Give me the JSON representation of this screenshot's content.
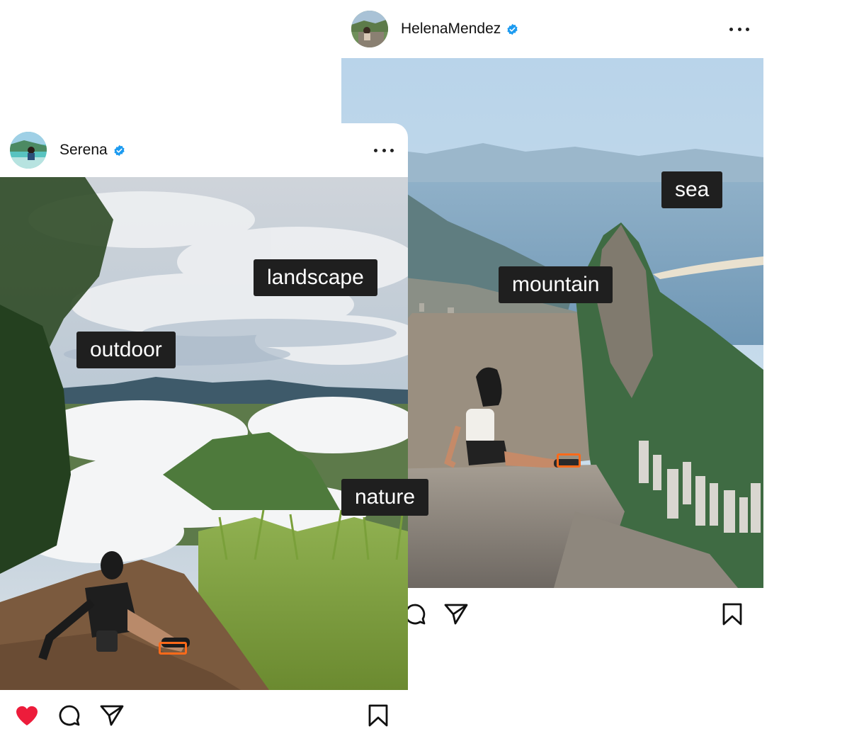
{
  "posts": [
    {
      "id": "back",
      "username": "HelenaMendez",
      "verified": true,
      "avatar_icon": "profile-photo",
      "actions": {
        "comment_icon": "comment-icon",
        "share_icon": "send-icon",
        "save_icon": "bookmark-icon"
      }
    },
    {
      "id": "front",
      "username": "Serena",
      "verified": true,
      "avatar_icon": "profile-photo",
      "actions": {
        "like_icon": "heart-icon",
        "liked": true,
        "comment_icon": "comment-icon",
        "share_icon": "send-icon",
        "save_icon": "bookmark-icon"
      }
    }
  ],
  "tags": {
    "sea": "sea",
    "mountain": "mountain",
    "landscape": "landscape",
    "outdoor": "outdoor",
    "nature": "nature"
  },
  "colors": {
    "verified_badge": "#1d9bf0",
    "like_red": "#ed1c3b",
    "tag_bg": "#1f1f1f",
    "highlight_box": "#ff6a1a"
  }
}
